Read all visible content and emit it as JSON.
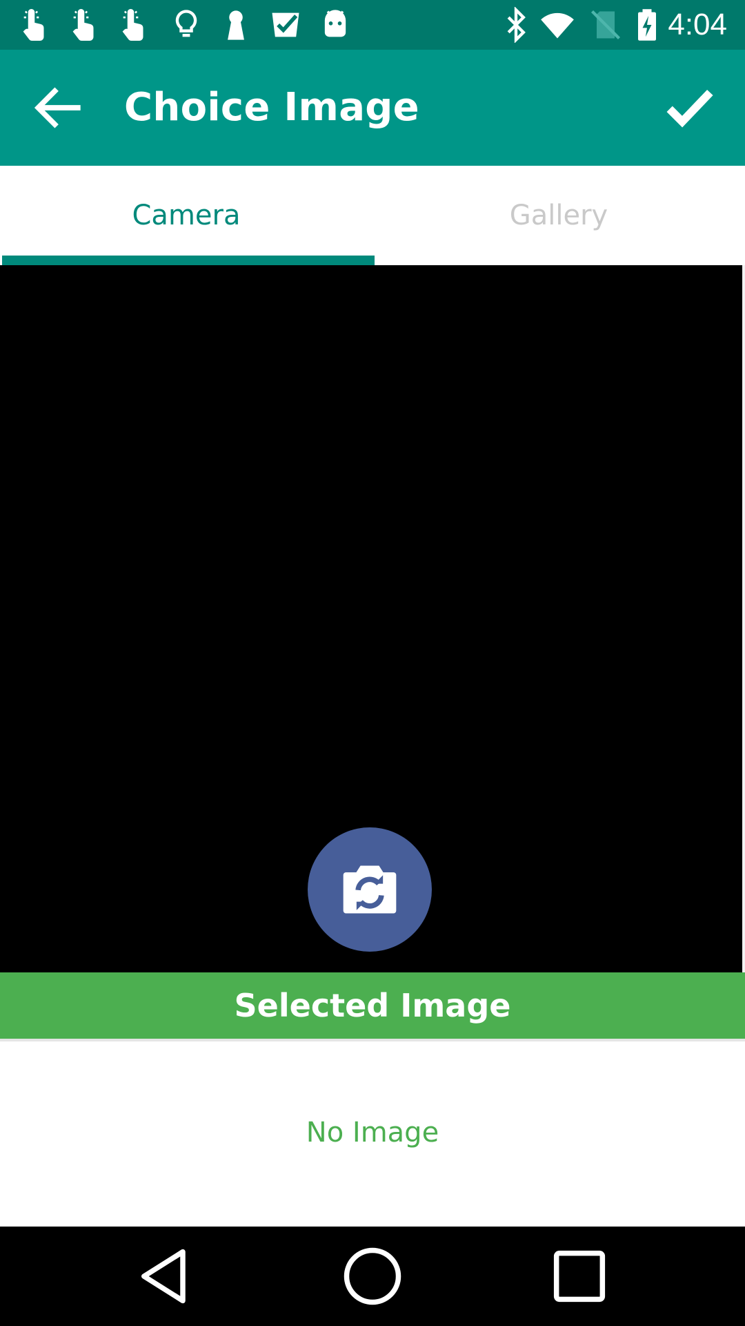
{
  "status_bar": {
    "time": "4:04",
    "left_icons": [
      "touch-icon",
      "touch-icon",
      "touch-icon",
      "lightbulb-icon",
      "keyhole-icon",
      "checklist-icon",
      "android-icon"
    ],
    "right_icons": [
      "bluetooth-icon",
      "wifi-icon",
      "no-sim-icon",
      "battery-charging-icon"
    ]
  },
  "app_bar": {
    "title": "Choice Image",
    "back_icon": "arrow-left-icon",
    "confirm_icon": "check-icon"
  },
  "tabs": [
    {
      "label": "Camera",
      "selected": true
    },
    {
      "label": "Gallery",
      "selected": false
    }
  ],
  "camera": {
    "switch_icon": "switch-camera-icon"
  },
  "selected_section": {
    "header": "Selected Image",
    "empty_text": "No Image"
  },
  "nav_bar": {
    "icons": [
      "back-triangle-icon",
      "home-circle-icon",
      "recents-square-icon"
    ]
  },
  "colors": {
    "status_bar": "#00796b",
    "app_bar": "#009688",
    "tab_active": "#00897b",
    "tab_inactive": "#c9c9c9",
    "camera_button": "#475e99",
    "selected_header": "#4caf50",
    "no_image_text": "#4caf50"
  }
}
